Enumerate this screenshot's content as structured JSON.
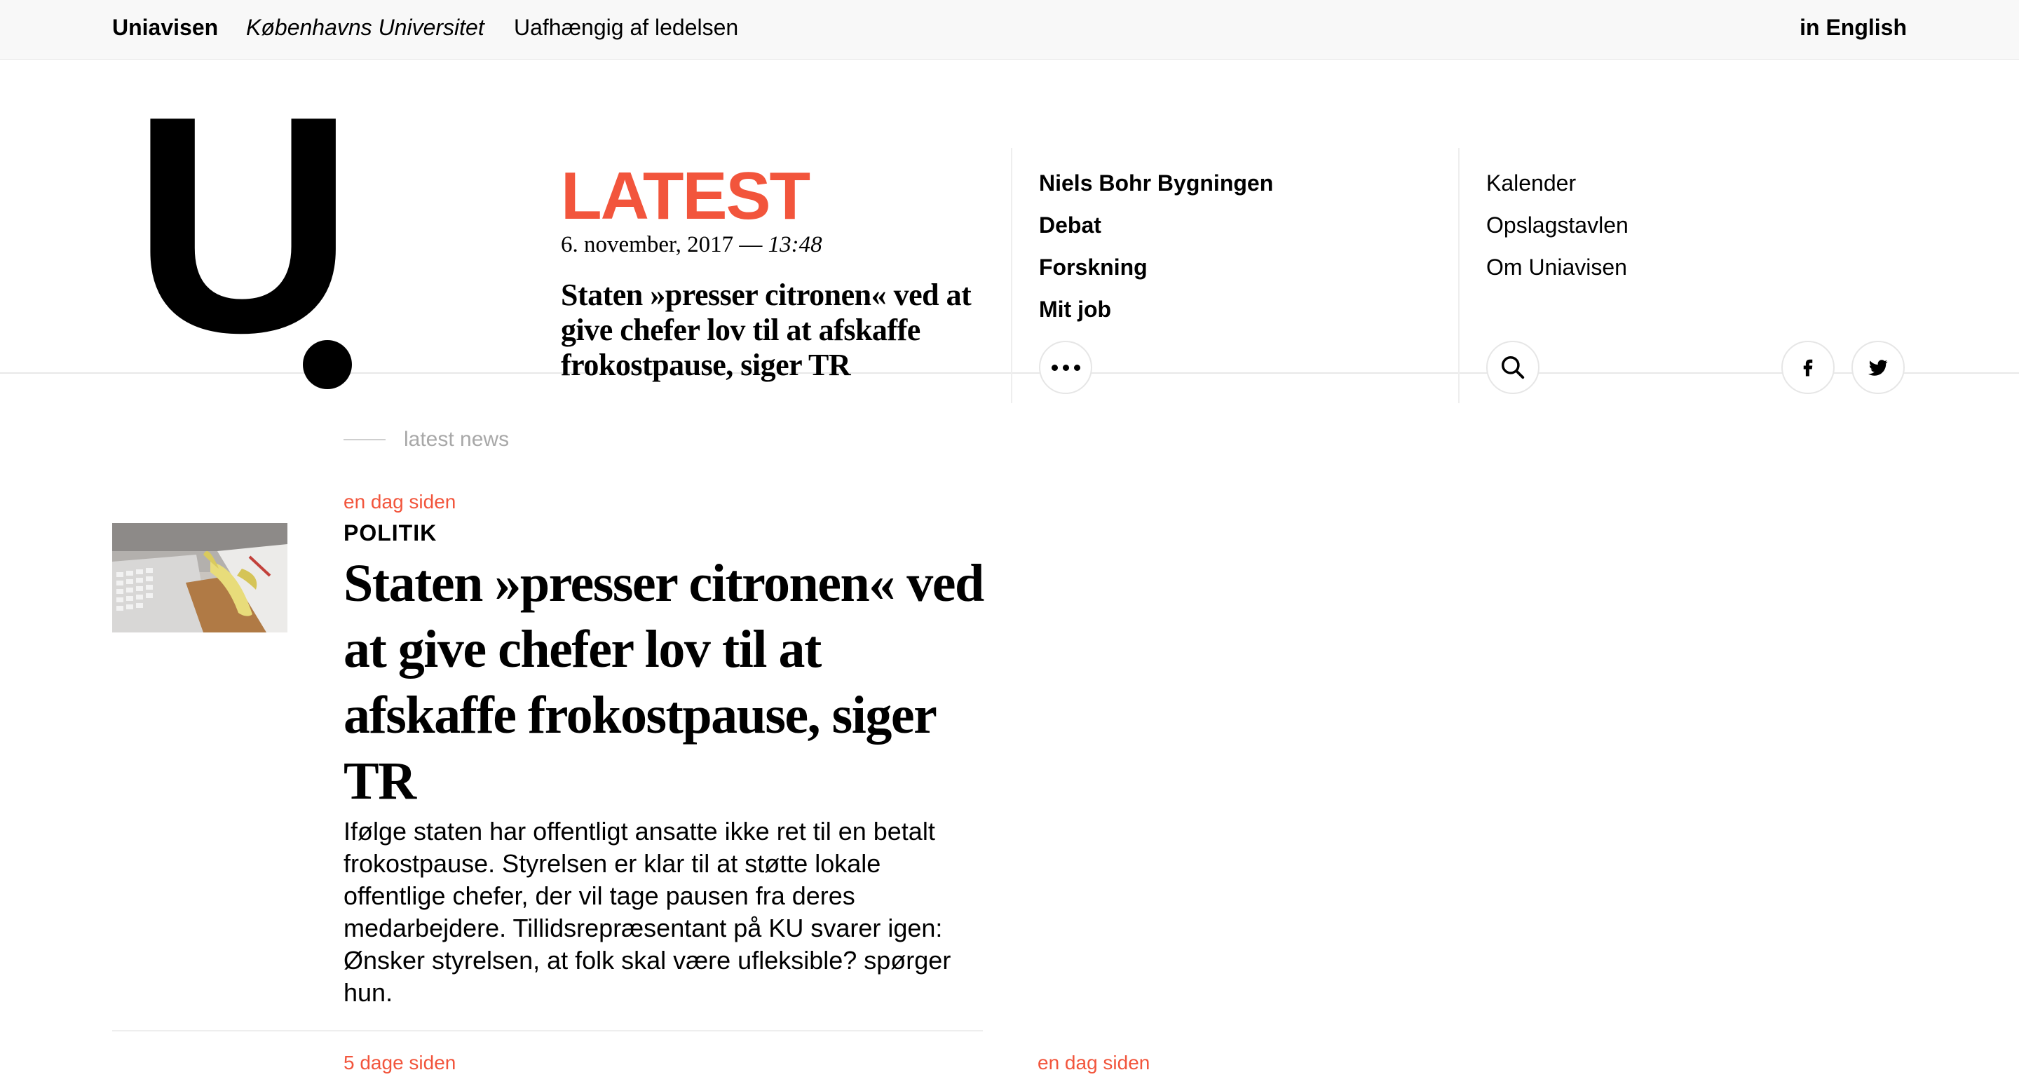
{
  "topbar": {
    "brand": "Uniavisen",
    "university": "Københavns Universitet",
    "independence": "Uafhængig af ledelsen",
    "language_link": "in English"
  },
  "logo": {
    "letter": "U"
  },
  "latest": {
    "label": "LATEST",
    "date": "6. november, 2017 —",
    "time": "13:48",
    "title": "Staten »presser citronen« ved at give chefer lov til at afskaffe frokostpause, siger TR"
  },
  "nav_primary": [
    {
      "label": "Niels Bohr Bygningen"
    },
    {
      "label": "Debat"
    },
    {
      "label": "Forskning"
    },
    {
      "label": "Mit job"
    }
  ],
  "nav_secondary": [
    {
      "label": "Kalender"
    },
    {
      "label": "Opslagstavlen"
    },
    {
      "label": "Om Uniavisen"
    }
  ],
  "icons": {
    "more": "more-dots-icon",
    "search": "search-icon",
    "facebook": "facebook-icon",
    "twitter": "twitter-icon"
  },
  "section_label": "latest news",
  "article": {
    "time_ago": "en dag siden",
    "category": "POLITIK",
    "headline": "Staten »presser citronen« ved at give chefer lov til at afskaffe frokostpause, siger TR",
    "summary": "Ifølge staten har offentligt ansatte ikke ret til en betalt frokostpause. Styrelsen er klar til at støtte lokale offentlige chefer, der vil tage pausen fra deres medarbejdere. Tillidsrepræsentant på KU svarer igen: Ønsker styrelsen, at folk skal være ufleksible? spørger hun."
  },
  "next_articles": [
    {
      "time_ago": "5 dage siden"
    },
    {
      "time_ago": "en dag siden"
    }
  ],
  "colors": {
    "accent": "#f2553c"
  }
}
